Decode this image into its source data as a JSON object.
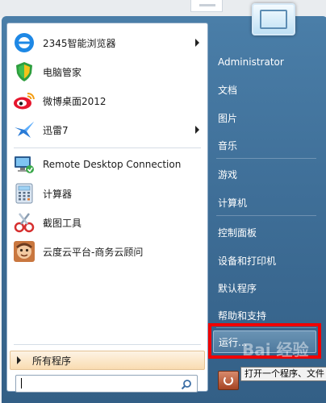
{
  "programs": [
    {
      "label": "2345智能浏览器",
      "icon": "browser-2345-icon",
      "submenu": true
    },
    {
      "label": "电脑管家",
      "icon": "pc-manager-shield-icon",
      "submenu": false
    },
    {
      "label": "微博桌面2012",
      "icon": "weibo-icon",
      "submenu": false
    },
    {
      "label": "迅雷7",
      "icon": "thunder-bird-icon",
      "submenu": true
    },
    {
      "label": "Remote Desktop Connection",
      "icon": "remote-desktop-icon",
      "submenu": false
    },
    {
      "label": "计算器",
      "icon": "calculator-icon",
      "submenu": false
    },
    {
      "label": "截图工具",
      "icon": "snipping-tool-icon",
      "submenu": false
    },
    {
      "label": "云度云平台-商务云顾问",
      "icon": "cloud-advisor-icon",
      "submenu": false
    }
  ],
  "all_programs": "所有程序",
  "search": {
    "value": "",
    "placeholder": ""
  },
  "right": {
    "user": "Administrator",
    "documents": "文档",
    "pictures": "图片",
    "music": "音乐",
    "games": "游戏",
    "computer": "计算机",
    "control_panel": "控制面板",
    "devices_printers": "设备和打印机",
    "default_programs": "默认程序",
    "help_support": "帮助和支持",
    "run": "运行...",
    "tooltip": "打开一个程序、文件"
  },
  "watermark": "Bai 经验",
  "colors": {
    "highlight": "#f00000",
    "menu_blue": "#3f6f98",
    "all_programs_bg": "#f9dcb1"
  }
}
